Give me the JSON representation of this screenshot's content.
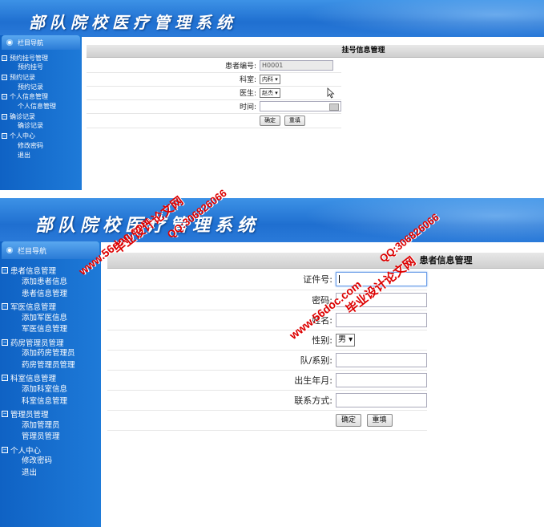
{
  "app": {
    "title": "部队院校医疗管理系统"
  },
  "panel1": {
    "nav_title": "栏目导航",
    "nav": [
      {
        "group": "预约挂号管理",
        "items": [
          "预约挂号"
        ]
      },
      {
        "group": "预约记录",
        "items": [
          "预约记录"
        ]
      },
      {
        "group": "个人信息管理",
        "items": [
          "个人信息管理"
        ]
      },
      {
        "group": "确诊记录",
        "items": [
          "确诊记录"
        ]
      },
      {
        "group": "个人中心",
        "items": [
          "修改密码",
          "退出"
        ]
      }
    ],
    "section_title": "挂号信息管理",
    "fields": {
      "patient_id_label": "患者编号:",
      "patient_id_value": "H0001",
      "dept_label": "科室:",
      "dept_value": "内科",
      "doctor_label": "医生:",
      "doctor_value": "赵杰",
      "time_label": "时间:"
    },
    "buttons": {
      "confirm": "确定",
      "reset": "重填"
    }
  },
  "panel2": {
    "nav_title": "栏目导航",
    "nav": [
      {
        "group": "患者信息管理",
        "items": [
          "添加患者信息",
          "患者信息管理"
        ]
      },
      {
        "group": "军医信息管理",
        "items": [
          "添加军医信息",
          "军医信息管理"
        ]
      },
      {
        "group": "药房管理员管理",
        "items": [
          "添加药房管理员",
          "药房管理员管理"
        ]
      },
      {
        "group": "科室信息管理",
        "items": [
          "添加科室信息",
          "科室信息管理"
        ]
      },
      {
        "group": "管理员管理",
        "items": [
          "添加管理员",
          "管理员管理"
        ]
      },
      {
        "group": "个人中心",
        "items": [
          "修改密码",
          "退出"
        ]
      }
    ],
    "section_title": "患者信息管理",
    "fields": {
      "id_label": "证件号:",
      "password_label": "密码:",
      "name_label": "姓名:",
      "gender_label": "性别:",
      "gender_value": "男",
      "unit_label": "队/系别:",
      "birth_label": "出生年月:",
      "contact_label": "联系方式:"
    },
    "buttons": {
      "confirm": "确定",
      "reset": "重填"
    }
  },
  "watermarks": {
    "site": "www.56doc.com",
    "name": "毕业设计论文网",
    "qq": "QQ:306826066"
  }
}
